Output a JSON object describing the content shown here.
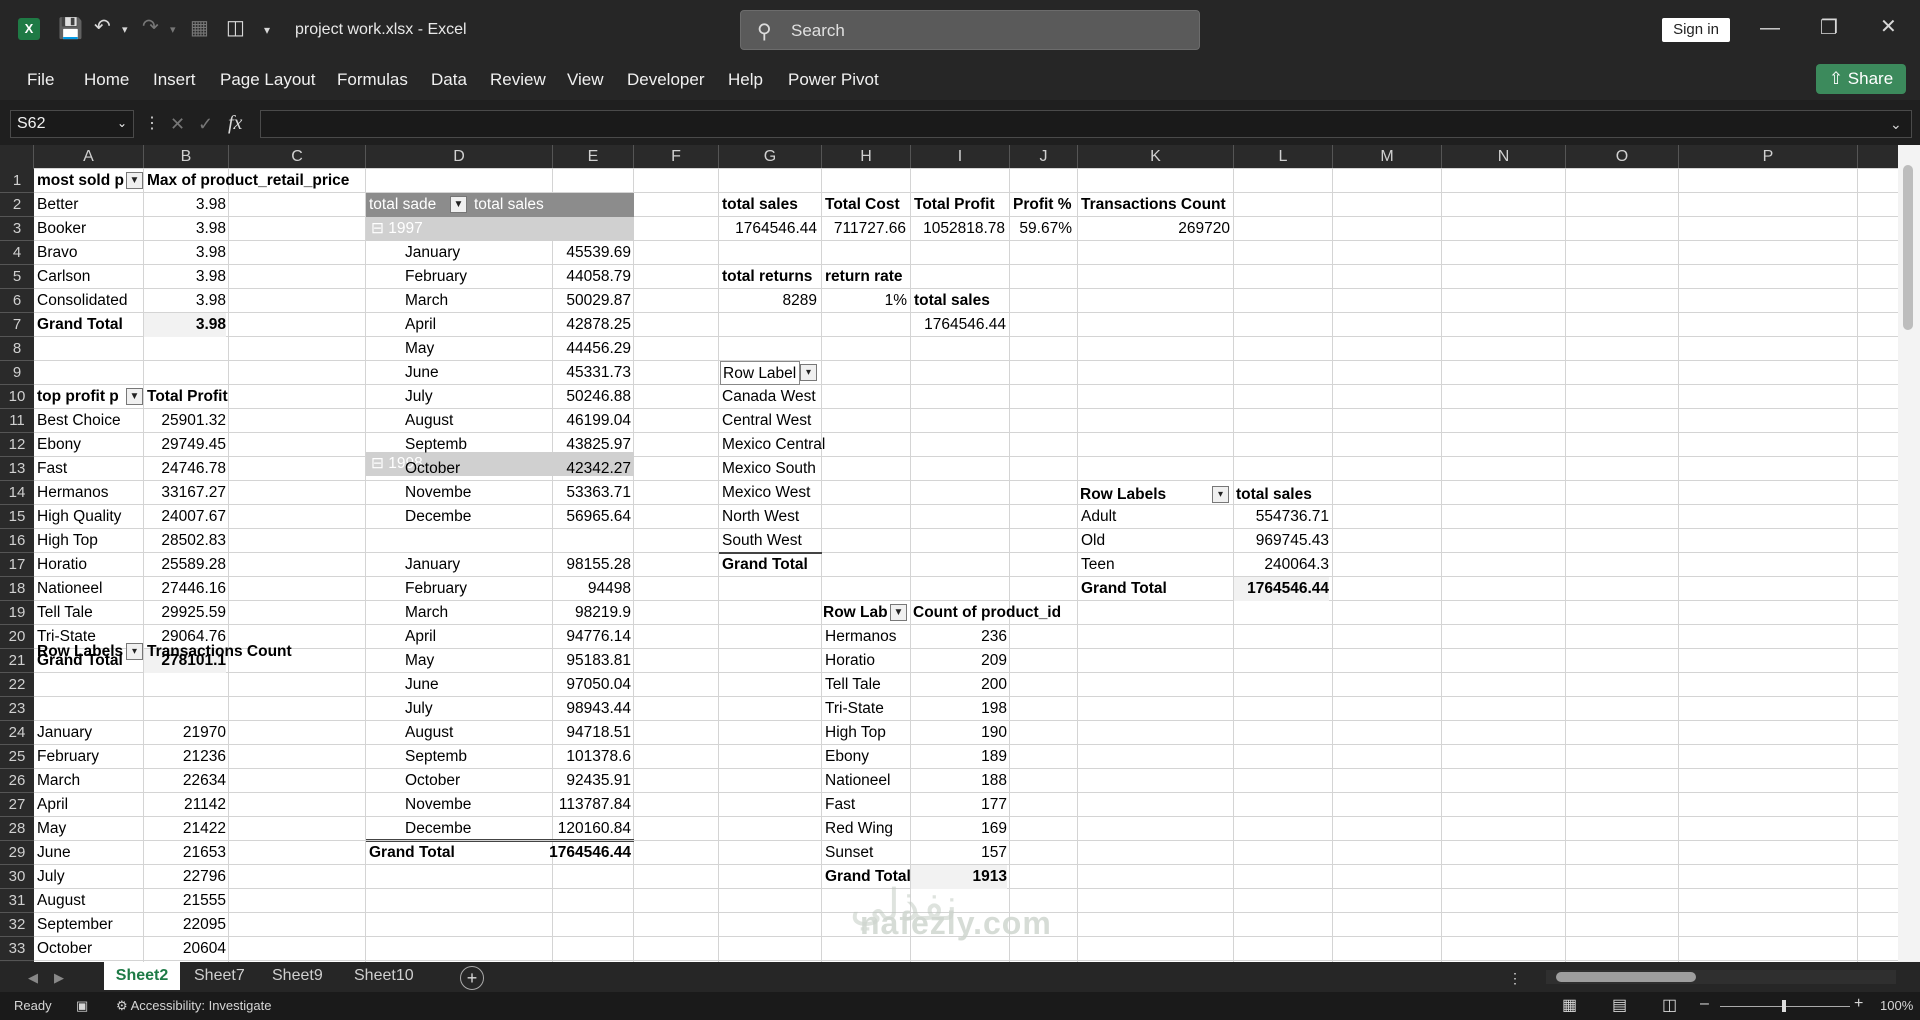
{
  "title": {
    "file": "project work.xlsx",
    "app": "Excel",
    "search_placeholder": "Search",
    "sign_in": "Sign in"
  },
  "menu": [
    "File",
    "Home",
    "Insert",
    "Page Layout",
    "Formulas",
    "Data",
    "Review",
    "View",
    "Developer",
    "Help",
    "Power Pivot"
  ],
  "share_label": "Share",
  "namebox": "S62",
  "columns": [
    "A",
    "B",
    "C",
    "D",
    "E",
    "F",
    "G",
    "H",
    "I",
    "J",
    "K",
    "L",
    "M",
    "N",
    "O",
    "P"
  ],
  "rows": [
    "1",
    "2",
    "3",
    "4",
    "5",
    "6",
    "7",
    "8",
    "9",
    "10",
    "11",
    "12",
    "13",
    "14",
    "15",
    "16",
    "17",
    "18",
    "19",
    "20",
    "21",
    "22",
    "23",
    "24",
    "25",
    "26",
    "27",
    "28",
    "29",
    "30",
    "31",
    "32",
    "33"
  ],
  "pivot_most_sold": {
    "header_a": "most sold p",
    "header_b": "Max of product_retail_price",
    "rows": [
      [
        "Better",
        "3.98"
      ],
      [
        "Booker",
        "3.98"
      ],
      [
        "Bravo",
        "3.98"
      ],
      [
        "Carlson",
        "3.98"
      ],
      [
        "Consolidated",
        "3.98"
      ]
    ],
    "total": [
      "Grand Total",
      "3.98"
    ]
  },
  "pivot_top_profit": {
    "header_a": "top profit p",
    "header_b": "Total Profit",
    "rows": [
      [
        "Best Choice",
        "25901.32"
      ],
      [
        "Ebony",
        "29749.45"
      ],
      [
        "Fast",
        "24746.78"
      ],
      [
        "Hermanos",
        "33167.27"
      ],
      [
        "High Quality",
        "24007.67"
      ],
      [
        "High Top",
        "28502.83"
      ],
      [
        "Horatio",
        "25589.28"
      ],
      [
        "Nationeel",
        "27446.16"
      ],
      [
        "Tell Tale",
        "29925.59"
      ],
      [
        "Tri-State",
        "29064.76"
      ]
    ],
    "total": [
      "Grand Total",
      "278101.1"
    ]
  },
  "pivot_transactions": {
    "header_a": "Row Labels",
    "header_b": "Transactions Count",
    "rows": [
      [
        "January",
        "21970"
      ],
      [
        "February",
        "21236"
      ],
      [
        "March",
        "22634"
      ],
      [
        "April",
        "21142"
      ],
      [
        "May",
        "21422"
      ],
      [
        "June",
        "21653"
      ],
      [
        "July",
        "22796"
      ],
      [
        "August",
        "21555"
      ],
      [
        "September",
        "22095"
      ],
      [
        "October",
        "20604"
      ]
    ]
  },
  "pivot_sales_by_date": {
    "header_d": "total sade",
    "header_e": "total sales",
    "year1": "1997",
    "months1": [
      [
        "January",
        "45539.69"
      ],
      [
        "February",
        "44058.79"
      ],
      [
        "March",
        "50029.87"
      ],
      [
        "April",
        "42878.25"
      ],
      [
        "May",
        "44456.29"
      ],
      [
        "June",
        "45331.73"
      ],
      [
        "July",
        "50246.88"
      ],
      [
        "August",
        "46199.04"
      ],
      [
        "Septemb",
        "43825.97"
      ],
      [
        "October",
        "42342.27"
      ],
      [
        "Novembe",
        "53363.71"
      ],
      [
        "Decembe",
        "56965.64"
      ]
    ],
    "year2": "1998",
    "months2": [
      [
        "January",
        "98155.28"
      ],
      [
        "February",
        "94498"
      ],
      [
        "March",
        "98219.9"
      ],
      [
        "April",
        "94776.14"
      ],
      [
        "May",
        "95183.81"
      ],
      [
        "June",
        "97050.04"
      ],
      [
        "July",
        "98943.44"
      ],
      [
        "August",
        "94718.51"
      ],
      [
        "Septemb",
        "101378.6"
      ],
      [
        "October",
        "92435.91"
      ],
      [
        "Novembe",
        "113787.84"
      ],
      [
        "Decembe",
        "120160.84"
      ]
    ],
    "total": [
      "Grand Total",
      "1764546.44"
    ]
  },
  "kpis": {
    "headers": [
      "total sales",
      "Total Cost",
      "Total Profit",
      "Profit %",
      "Transactions Count"
    ],
    "values": [
      "1764546.44",
      "711727.66",
      "1052818.78",
      "59.67%",
      "269720"
    ],
    "returns_header": "total returns",
    "returns_value": "8289",
    "rate_header": "return rate",
    "rate_value": "1%",
    "sales_header": "total sales",
    "sales_value": "1764546.44"
  },
  "pivot_regions": {
    "header": "Row Label",
    "rows": [
      "Canada West",
      "Central West",
      "Mexico Central",
      "Mexico South",
      "Mexico West",
      "North West",
      "South West"
    ],
    "total": "Grand Total"
  },
  "pivot_age": {
    "header_a": "Row Labels",
    "header_b": "total sales",
    "rows": [
      [
        "Adult",
        "554736.71"
      ],
      [
        "Old",
        "969745.43"
      ],
      [
        "Teen",
        "240064.3"
      ]
    ],
    "total": [
      "Grand Total",
      "1764546.44"
    ]
  },
  "pivot_brand_count": {
    "header_a": "Row Lab",
    "header_b": "Count of product_id",
    "rows": [
      [
        "Hermanos",
        "236"
      ],
      [
        "Horatio",
        "209"
      ],
      [
        "Tell Tale",
        "200"
      ],
      [
        "Tri-State",
        "198"
      ],
      [
        "High Top",
        "190"
      ],
      [
        "Ebony",
        "189"
      ],
      [
        "Nationeel",
        "188"
      ],
      [
        "Fast",
        "177"
      ],
      [
        "Red Wing",
        "169"
      ],
      [
        "Sunset",
        "157"
      ]
    ],
    "total": [
      "Grand Total",
      "1913"
    ]
  },
  "sheets": [
    "Sheet2",
    "Sheet7",
    "Sheet9",
    "Sheet10"
  ],
  "active_sheet": "Sheet2",
  "status": {
    "ready": "Ready",
    "accessibility": "Accessibility: Investigate",
    "zoom": "100%"
  },
  "watermark": "nafezly.com"
}
